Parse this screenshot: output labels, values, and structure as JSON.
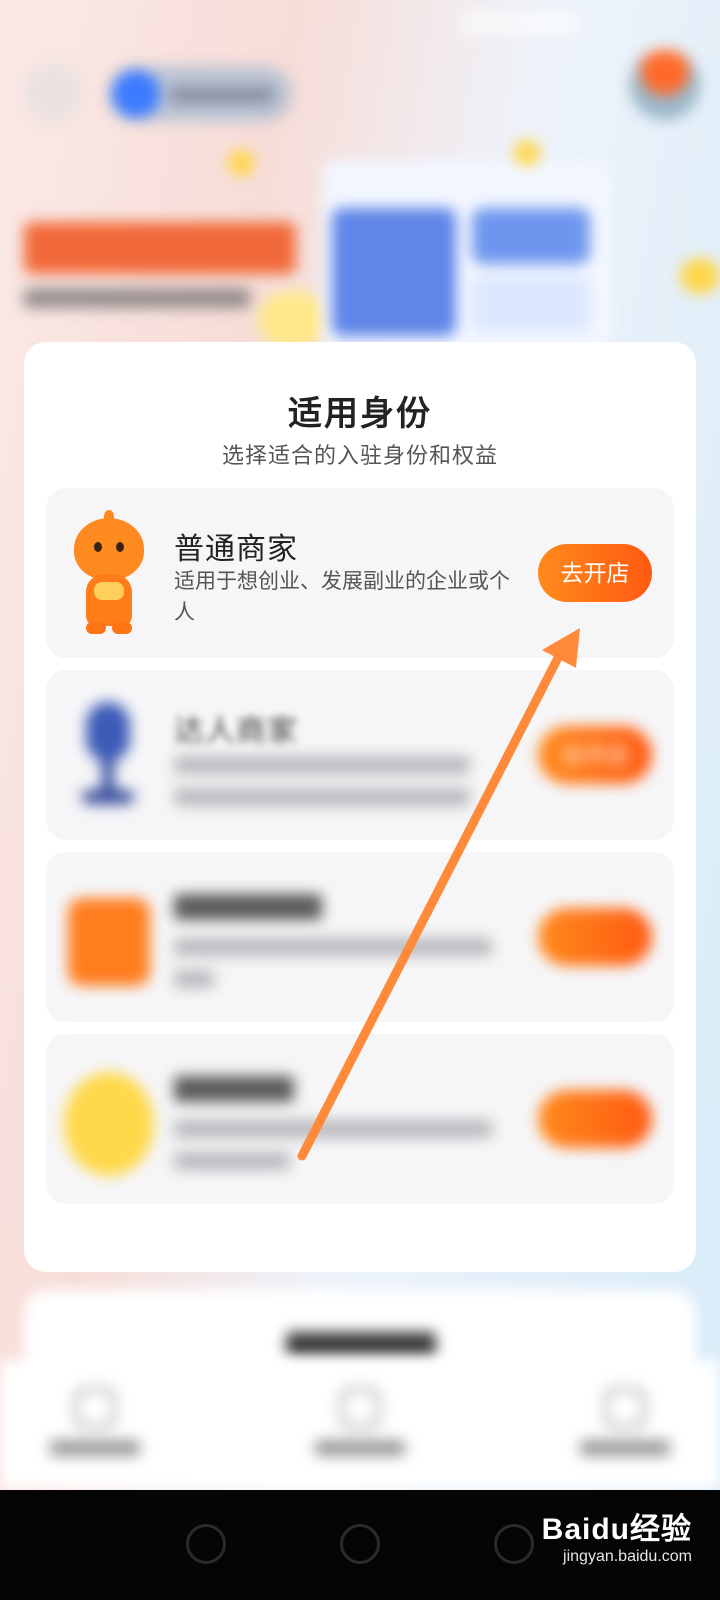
{
  "identity_section": {
    "title": "适用身份",
    "subtitle": "选择适合的入驻身份和权益"
  },
  "options": [
    {
      "name": "普通商家",
      "description": "适用于想创业、发展副业的企业或个人",
      "button_label": "去开店",
      "state": "clear"
    },
    {
      "name": "达人商家",
      "button_label": "去开店",
      "state": "blurred"
    },
    {
      "state": "blurred"
    },
    {
      "state": "blurred"
    }
  ],
  "watermark": {
    "brand": "Baidu经验",
    "url": "jingyan.baidu.com"
  },
  "colors": {
    "accent_orange": "#ff6a14",
    "arrow_orange": "#ff8a3a",
    "card_bg": "#ffffff",
    "option_bg": "#f6f6f8"
  }
}
